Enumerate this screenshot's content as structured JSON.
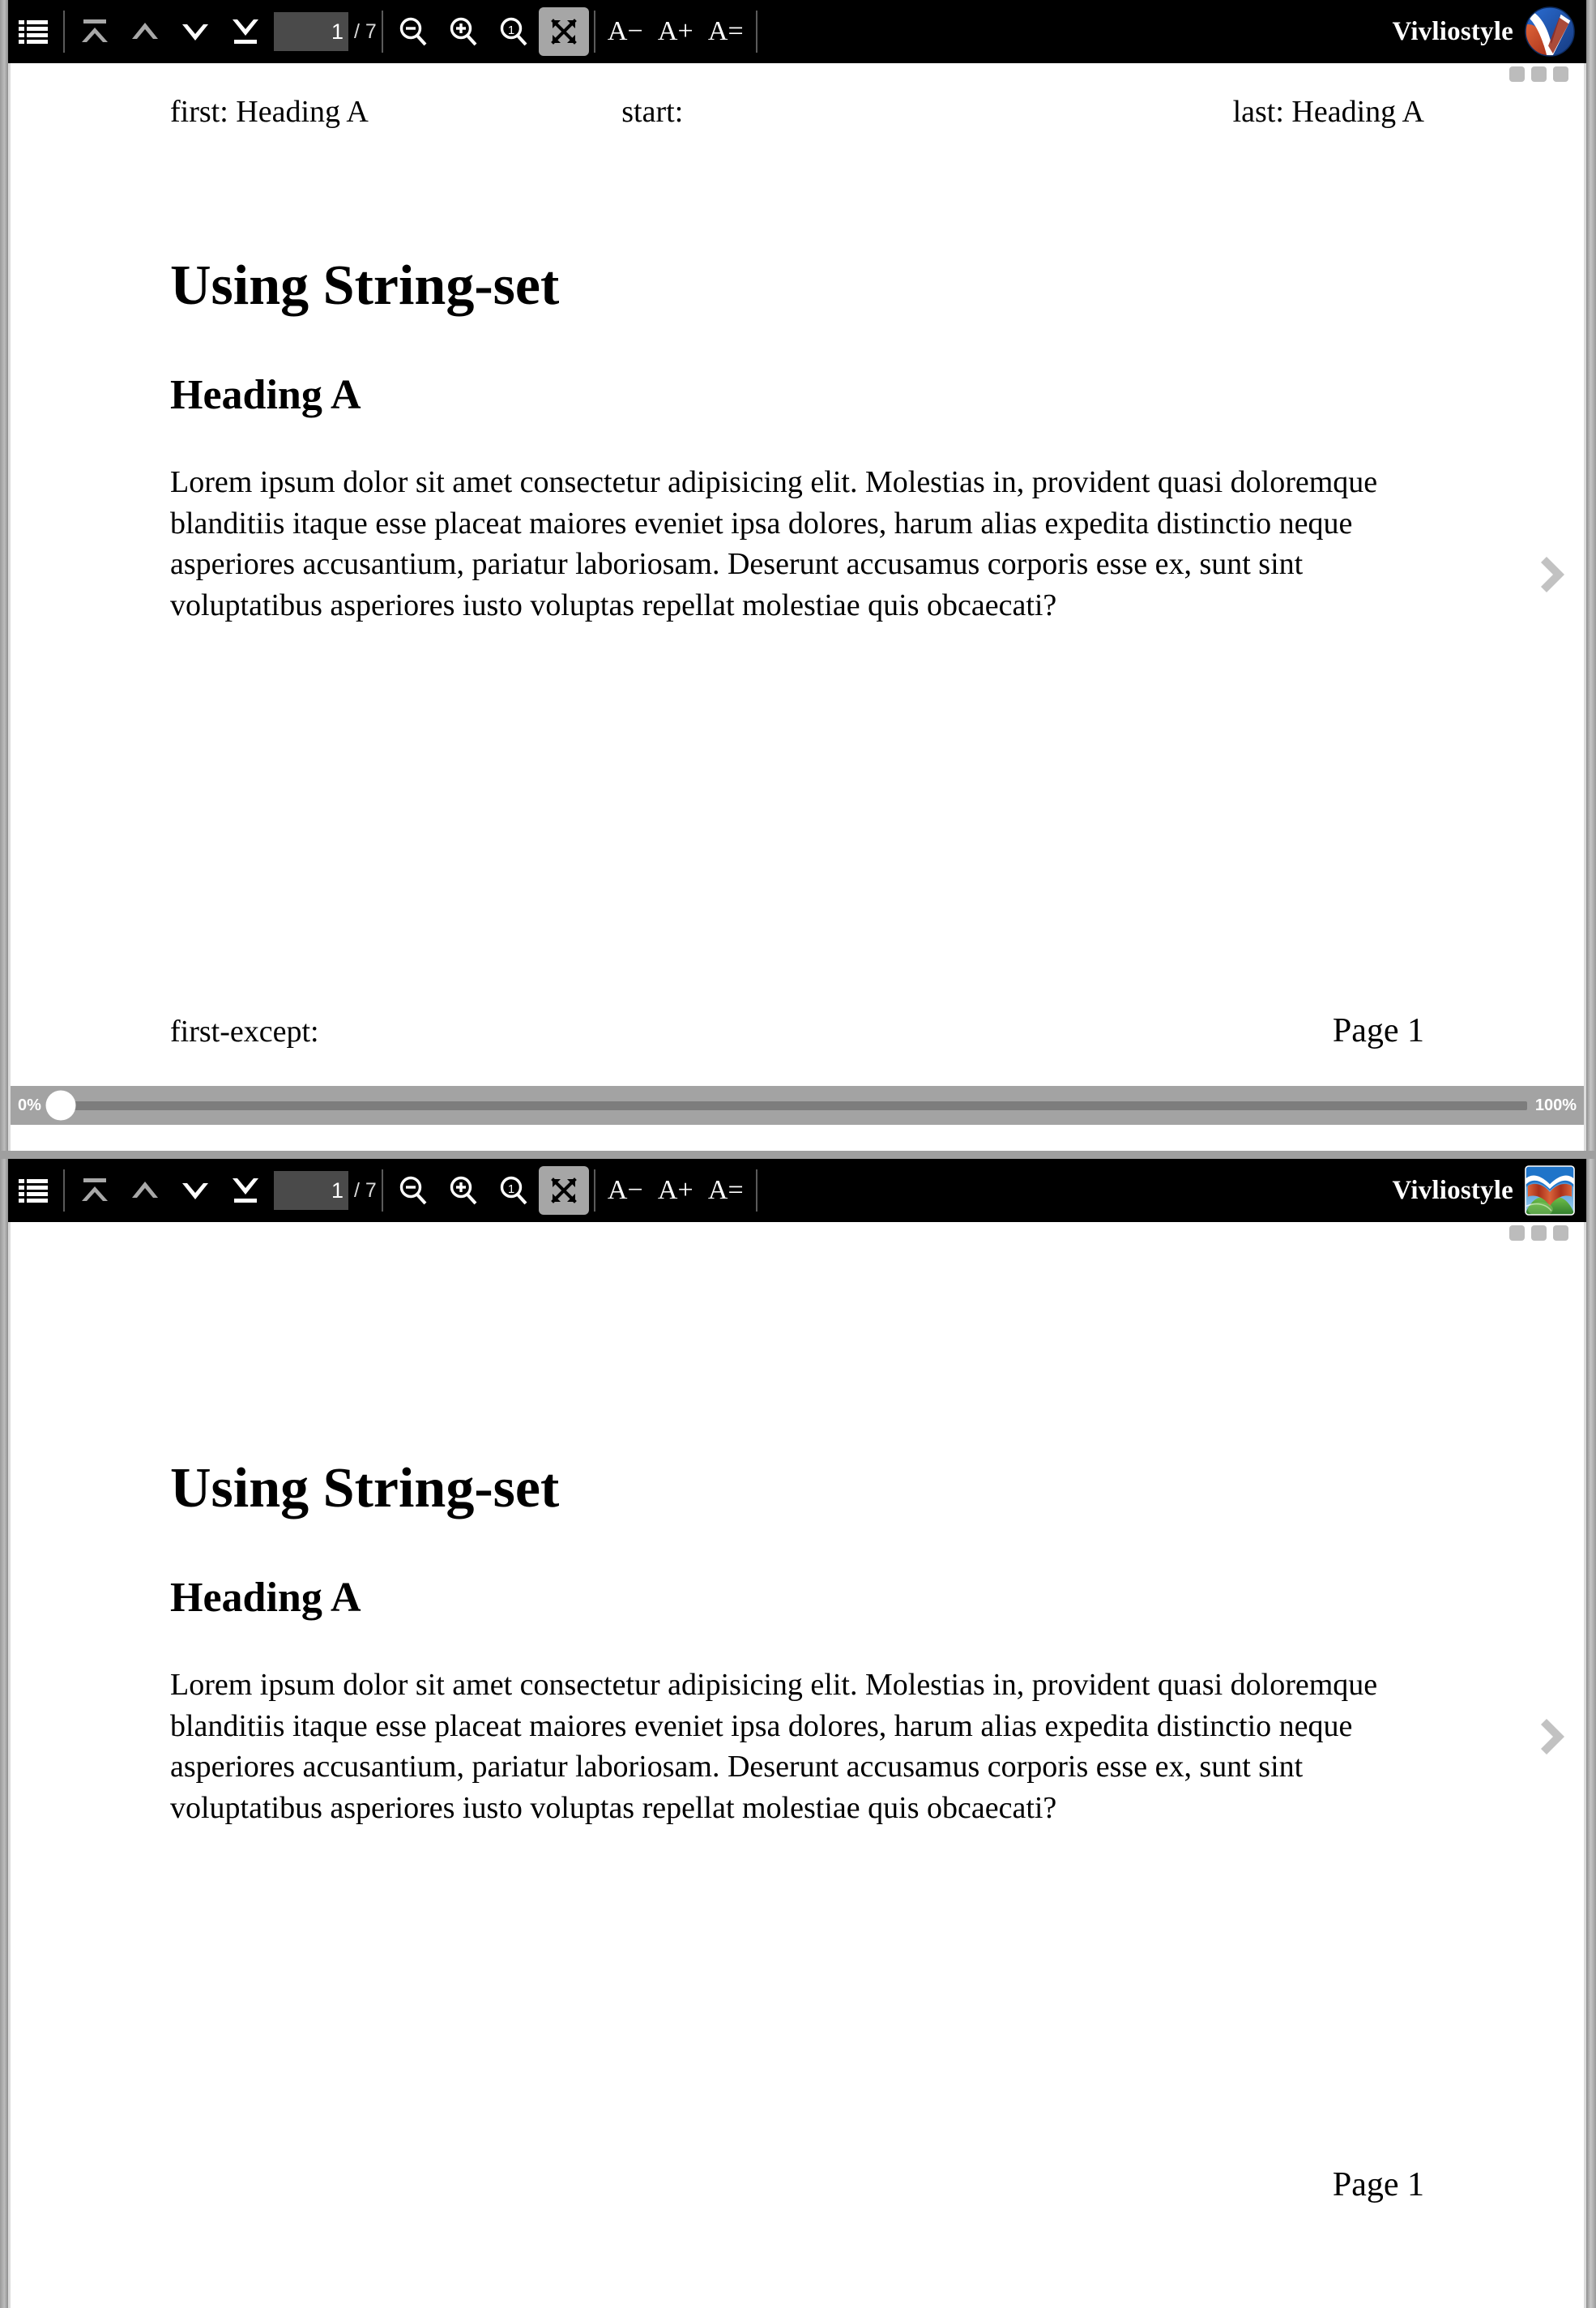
{
  "app": {
    "brand_name": "Vivliostyle",
    "logo_icon_top": "vivliostyle-circle-logo-icon",
    "logo_icon_bottom": "vivliostyle-landscape-logo-icon"
  },
  "toolbar": {
    "toc_label": "Table of Contents",
    "first_page_label": "First Page",
    "prev_page_label": "Previous Page",
    "next_page_label": "Next Page",
    "last_page_label": "Last Page",
    "page_number_value": "1",
    "page_total_text": "/ 7",
    "page_number_placeholder": "1",
    "zoom_out_label": "Zoom Out",
    "zoom_in_label": "Zoom In",
    "zoom_actual_label": "Actual Size",
    "fit_to_screen_label": "Fit To Screen",
    "fit_to_screen_active": true,
    "font_smaller_label": "A−",
    "font_larger_label": "A+",
    "font_default_label": "A="
  },
  "progress": {
    "start_label": "0%",
    "end_label": "100%",
    "value_percent": 0
  },
  "document": {
    "title": "Using String-set",
    "heading": "Heading A",
    "paragraph": "Lorem ipsum dolor sit amet consectetur adipisicing elit. Molestias in, provident quasi doloremque blanditiis itaque esse placeat maiores eveniet ipsa dolores, harum alias expedita distinctio neque asperiores accusantium, pariatur laboriosam. Deserunt accusamus corporis esse ex, sunt sint voluptatibus asperiores iusto voluptas repellat molestiae quis obcaecati?"
  },
  "page_one": {
    "running_head_first": "first: Heading A",
    "running_head_start": "start:",
    "running_head_last": "last: Heading A",
    "running_foot_left": "first-except:",
    "running_foot_right": "Page 1"
  },
  "page_two": {
    "running_head_first": "",
    "running_head_start": "",
    "running_head_last": "",
    "running_foot_left": "",
    "running_foot_right": "Page 1"
  },
  "nav": {
    "next_chevron_icon": "chevron-right-icon"
  },
  "colors": {
    "toolbar_bg": "#000000",
    "toolbar_fg": "#ffffff",
    "active_btn_bg": "#a6a6a6",
    "page_field_bg": "#4a4a4a",
    "progress_bg": "#a3a3a3",
    "progress_track": "#7d7d7d",
    "desktop_bg": "#aeaeae",
    "brand_blue": "#1f5fbf",
    "brand_orange": "#d1552b"
  }
}
